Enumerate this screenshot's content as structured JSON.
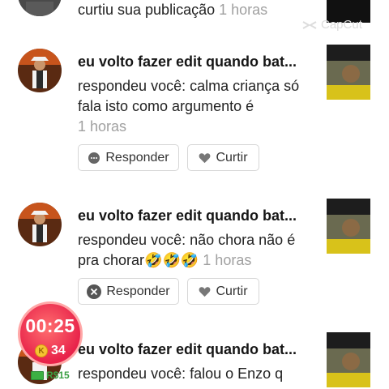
{
  "notifications": [
    {
      "action_text": "curtiu sua publicação",
      "time": "1 horas"
    },
    {
      "username": "eu volto fazer edit quando bat...",
      "comment": "respondeu você: calma criança só fala isto como argumento  é",
      "time": "1 horas",
      "reply_label": "Responder",
      "like_label": "Curtir"
    },
    {
      "username": "eu volto fazer edit quando bat...",
      "comment": "respondeu você: não chora não é pra chorar🤣🤣🤣",
      "time": "1 horas",
      "reply_label": "Responder",
      "like_label": "Curtir"
    },
    {
      "username": "eu volto fazer edit quando bat...",
      "comment": "respondeu você: falou o Enzo q"
    }
  ],
  "watermark": "CapCut",
  "timer": {
    "time": "00:25",
    "coin_symbol": "K",
    "coins": "34",
    "reward": "R$15"
  },
  "colors": {
    "timer_red": "#e8224a",
    "reward_green": "#3a9f43",
    "muted_text": "#a0a0a0"
  }
}
